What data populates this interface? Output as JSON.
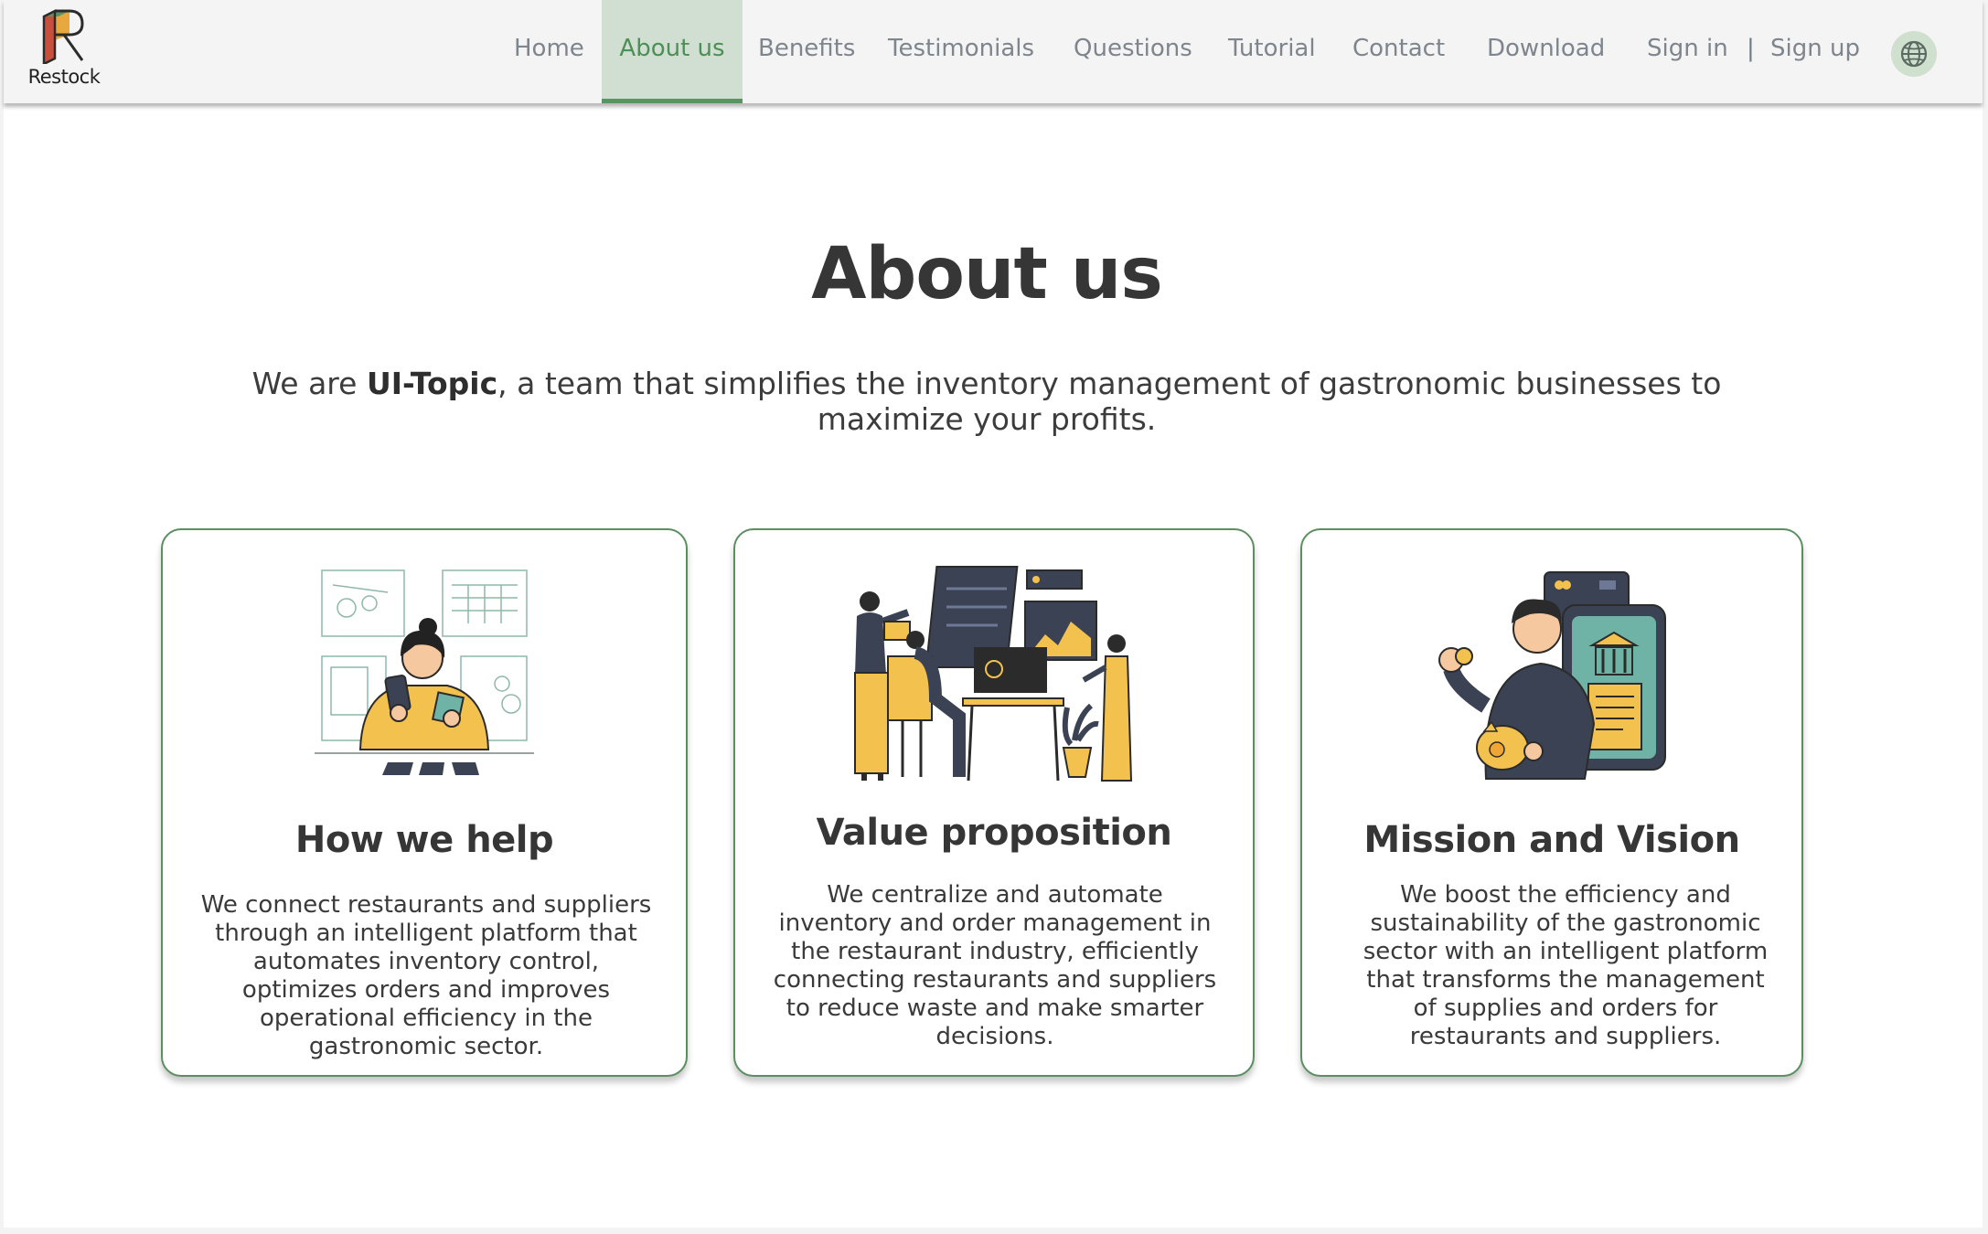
{
  "brand": {
    "name": "Restock"
  },
  "nav": {
    "items": [
      {
        "label": "Home"
      },
      {
        "label": "About us"
      },
      {
        "label": "Benefits"
      },
      {
        "label": "Testimonials"
      },
      {
        "label": "Questions"
      },
      {
        "label": "Tutorial"
      },
      {
        "label": "Contact"
      },
      {
        "label": "Download"
      }
    ],
    "active": "About us",
    "sign_in": "Sign in",
    "separator": "|",
    "sign_up": "Sign up",
    "language_icon": "globe-icon"
  },
  "hero": {
    "title": "About us",
    "intro_prefix": "We are ",
    "intro_team": "UI-Topic",
    "intro_suffix": ", a team that simplifies the inventory management of gastronomic businesses to maximize your profits."
  },
  "cards": [
    {
      "illustration": "woman-with-phone-and-cash-illustration",
      "title": "How we help",
      "text": "We connect restaurants and suppliers through an intelligent platform that automates inventory control, optimizes orders and improves operational efficiency in the gastronomic sector."
    },
    {
      "illustration": "team-with-dashboard-illustration",
      "title": "Value proposition",
      "text": "We centralize and automate inventory and order management in the restaurant industry, efficiently connecting restaurants and suppliers to reduce waste and make smarter decisions."
    },
    {
      "illustration": "man-with-piggy-bank-and-banking-app-illustration",
      "title": "Mission and Vision",
      "text": "We boost the efficiency and sustainability of the gastronomic sector with an intelligent platform that transforms the management of supplies and orders for restaurants and suppliers."
    }
  ],
  "colors": {
    "accent": "#5a9463",
    "nav_active_bg": "#d1dfd2",
    "nav_text": "#7e858c",
    "illustration_yellow": "#f2c14e",
    "illustration_navy": "#3a4253",
    "illustration_teal": "#6fb3a6"
  }
}
